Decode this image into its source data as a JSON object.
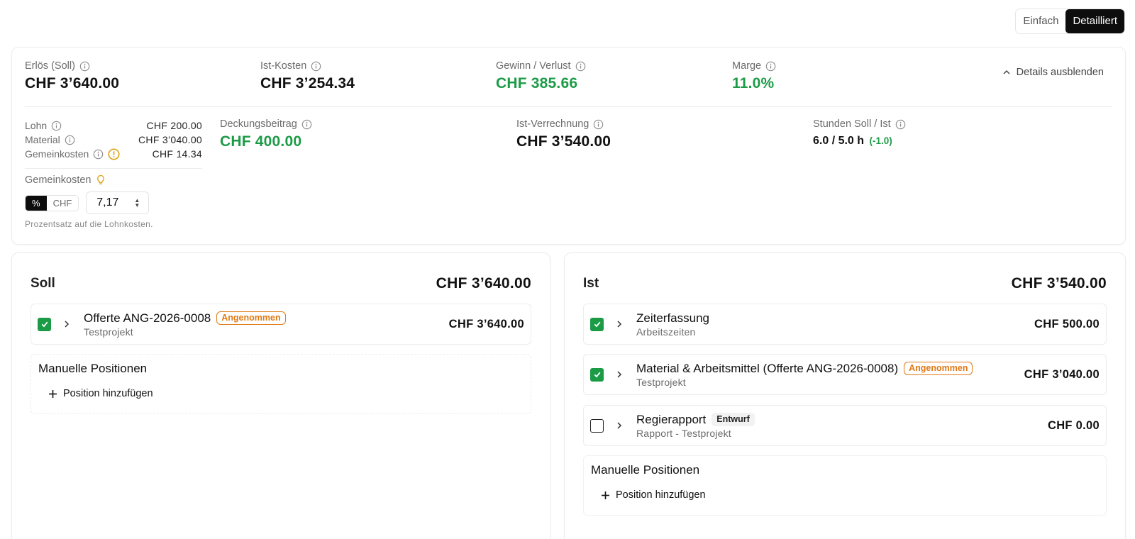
{
  "view_toggle": {
    "simple": "Einfach",
    "detailed": "Detailliert"
  },
  "kpis": {
    "revenue": {
      "label": "Erlös (Soll)",
      "value": "CHF 3’640.00"
    },
    "actual_costs": {
      "label": "Ist-Kosten",
      "value": "CHF 3’254.34"
    },
    "profit": {
      "label": "Gewinn / Verlust",
      "value": "CHF 385.66"
    },
    "margin": {
      "label": "Marge",
      "value": "11.0%"
    }
  },
  "hide_details": "Details ausblenden",
  "breakdown": [
    {
      "label": "Lohn",
      "value": "CHF 200.00"
    },
    {
      "label": "Material",
      "value": "CHF 3’040.00"
    },
    {
      "label": "Gemeinkosten",
      "value": "CHF 14.34"
    }
  ],
  "overhead": {
    "label": "Gemeinkosten",
    "mode_percent": "%",
    "mode_chf": "CHF",
    "input_value": "7,17",
    "hint": "Prozentsatz auf die Lohnkosten."
  },
  "contribution": {
    "label": "Deckungsbeitrag",
    "value": "CHF 400.00"
  },
  "actual_billing": {
    "label": "Ist-Verrechnung",
    "value": "CHF 3’540.00"
  },
  "hours": {
    "label": "Stunden Soll / Ist",
    "value": "6.0 / 5.0 h",
    "delta": "(-1.0)"
  },
  "soll": {
    "title": "Soll",
    "total": "CHF 3’640.00",
    "items": [
      {
        "title": "Offerte ANG-2026-0008",
        "badge": "Angenommen",
        "subtitle": "Testprojekt",
        "amount": "CHF 3’640.00",
        "checked": true
      }
    ],
    "manual_title": "Manuelle Positionen",
    "add_label": "Position hinzufügen"
  },
  "ist": {
    "title": "Ist",
    "total": "CHF 3’540.00",
    "items": [
      {
        "title": "Zeiterfassung",
        "subtitle": "Arbeitszeiten",
        "amount": "CHF 500.00",
        "checked": true
      },
      {
        "title": "Material & Arbeitsmittel (Offerte ANG-2026-0008)",
        "badge": "Angenommen",
        "subtitle": "Testprojekt",
        "amount": "CHF 3’040.00",
        "checked": true
      },
      {
        "title": "Regierapport",
        "badge": "Entwurf",
        "subtitle": "Rapport - Testprojekt",
        "amount": "CHF 0.00",
        "checked": false
      }
    ],
    "manual_title": "Manuelle Positionen",
    "add_label": "Position hinzufügen"
  },
  "colors": {
    "positive": "#1c9b47",
    "accepted": "#e07a16",
    "dark": "#0d0d0d"
  }
}
